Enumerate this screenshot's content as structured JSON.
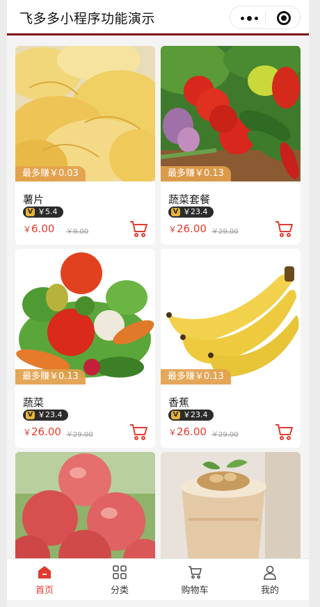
{
  "header": {
    "title": "飞多多小程序功能演示"
  },
  "products": [
    {
      "name": "薯片",
      "badge": "最多赚￥0.03",
      "vip_price": "￥5.4",
      "price_symbol": "￥",
      "price": "6.00",
      "old_price": "￥9.00",
      "vip_mark": "V"
    },
    {
      "name": "蔬菜套餐",
      "badge": "最多赚￥0.13",
      "vip_price": "￥23.4",
      "price_symbol": "￥",
      "price": "26.00",
      "old_price": "￥29.00",
      "vip_mark": "V"
    },
    {
      "name": "蔬菜",
      "badge": "最多赚￥0.13",
      "vip_price": "￥23.4",
      "price_symbol": "￥",
      "price": "26.00",
      "old_price": "￥29.00",
      "vip_mark": "V"
    },
    {
      "name": "香蕉",
      "badge": "最多赚￥0.13",
      "vip_price": "￥23.4",
      "price_symbol": "￥",
      "price": "26.00",
      "old_price": "￥29.00",
      "vip_mark": "V"
    }
  ],
  "tabbar": {
    "items": [
      {
        "label": "首页",
        "icon": "home-icon",
        "active": true
      },
      {
        "label": "分类",
        "icon": "grid-icon",
        "active": false
      },
      {
        "label": "购物车",
        "icon": "cart-icon",
        "active": false
      },
      {
        "label": "我的",
        "icon": "user-icon",
        "active": false
      }
    ]
  },
  "colors": {
    "accent": "#e23b2e",
    "badge": "#e2a04c",
    "header_border": "#7a1212"
  }
}
